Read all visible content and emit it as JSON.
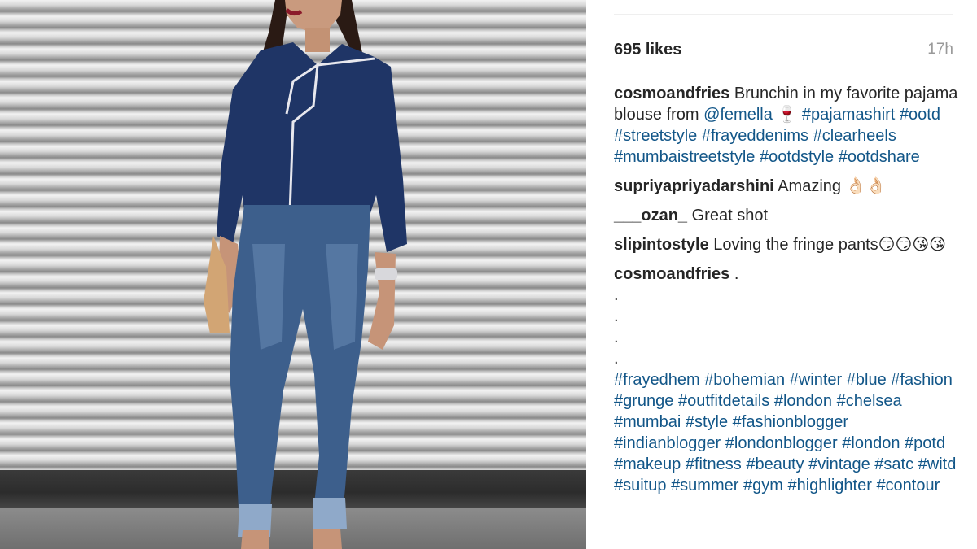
{
  "post": {
    "likes": "695 likes",
    "timestamp": "17h"
  },
  "comments": [
    {
      "user": "cosmoandfries",
      "parts": [
        {
          "t": " Brunchin in my favorite pajama blouse from "
        },
        {
          "t": "@femella",
          "link": true
        },
        {
          "t": " 🍷 "
        },
        {
          "t": "#pajamashirt",
          "link": true
        },
        {
          "t": " "
        },
        {
          "t": "#ootd",
          "link": true
        },
        {
          "t": " "
        },
        {
          "t": "#streetstyle",
          "link": true
        },
        {
          "t": " "
        },
        {
          "t": "#frayeddenims",
          "link": true
        },
        {
          "t": " "
        },
        {
          "t": "#clearheels",
          "link": true
        },
        {
          "t": " "
        },
        {
          "t": "#mumbaistreetstyle",
          "link": true
        },
        {
          "t": " "
        },
        {
          "t": "#ootdstyle",
          "link": true
        },
        {
          "t": " "
        },
        {
          "t": "#ootdshare",
          "link": true
        }
      ]
    },
    {
      "user": "supriyapriyadarshini",
      "parts": [
        {
          "t": " Amazing 👌🏻👌🏻"
        }
      ]
    },
    {
      "user": "___ozan_",
      "parts": [
        {
          "t": " Great shot"
        }
      ]
    },
    {
      "user": "slipintostyle",
      "parts": [
        {
          "t": " Loving the fringe pants😏😏😘😘"
        }
      ]
    },
    {
      "user": "cosmoandfries",
      "parts": [
        {
          "t": " ."
        }
      ],
      "dots": [
        ".",
        ".",
        ".",
        "."
      ],
      "hashtags": [
        "#frayedhem",
        "#bohemian",
        "#winter",
        "#blue",
        "#fashion",
        "#grunge",
        "#outfitdetails",
        "#london",
        "#chelsea",
        "#mumbai",
        "#style",
        "#fashionblogger",
        "#indianblogger",
        "#londonblogger",
        "#london",
        "#potd",
        "#makeup",
        "#fitness",
        "#beauty",
        "#vintage",
        "#satc",
        "#witd",
        "#suitup",
        "#summer",
        "#gym",
        "#highlighter",
        "#contour"
      ]
    }
  ],
  "colors": {
    "link": "#125688",
    "text": "#262626",
    "muted": "#999999"
  }
}
